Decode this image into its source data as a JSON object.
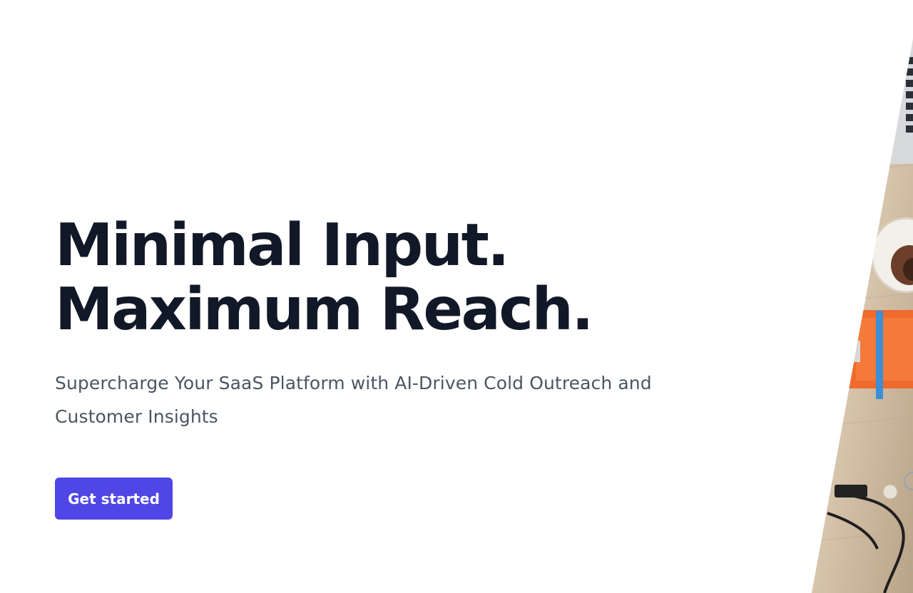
{
  "hero": {
    "headline_line1": "Minimal Input.",
    "headline_line2": "Maximum Reach.",
    "subtitle": "Supercharge Your SaaS Platform with AI-Driven Cold Outreach and Customer Insights",
    "cta_label": "Get started"
  },
  "theme": {
    "accent": "#4f46e5",
    "heading": "#111827",
    "body_text": "#4b5563"
  },
  "image": {
    "subject": "desk-workspace-photo"
  }
}
